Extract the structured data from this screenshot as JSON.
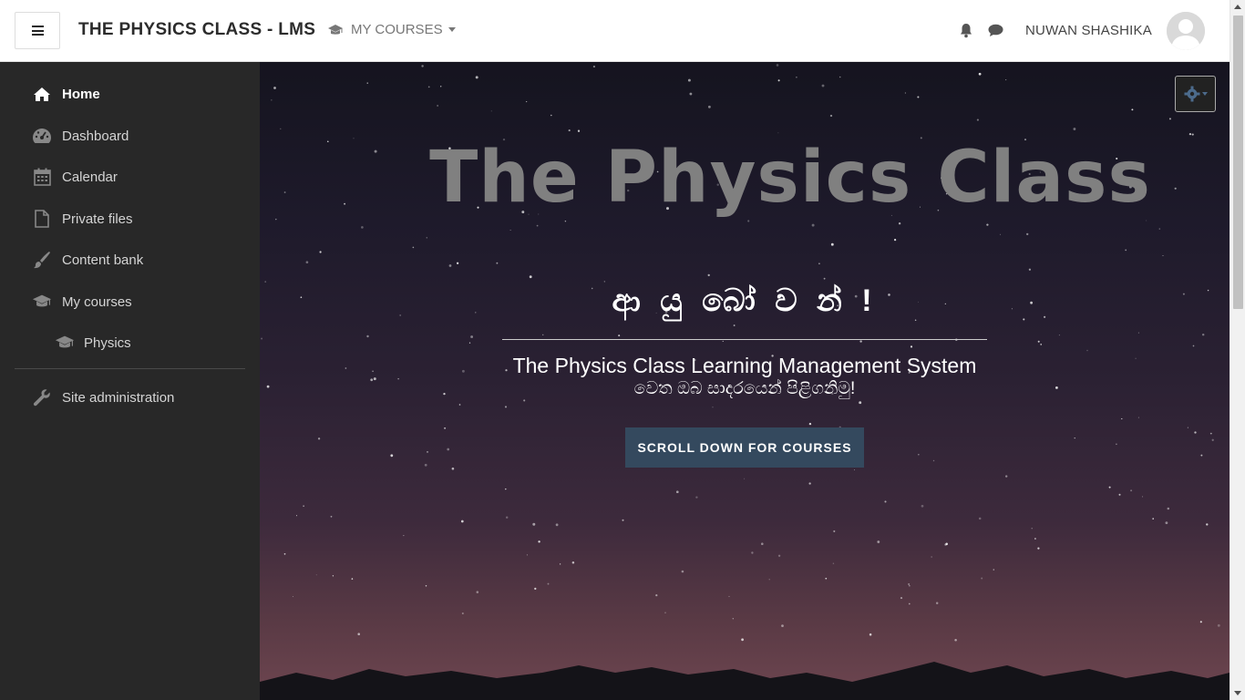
{
  "navbar": {
    "site_name": "THE PHYSICS CLASS - LMS",
    "mycourses_label": "MY COURSES",
    "username": "NUWAN SHASHIKA"
  },
  "sidebar": {
    "items": [
      {
        "label": "Home",
        "icon": "home-icon",
        "active": true
      },
      {
        "label": "Dashboard",
        "icon": "dashboard-icon"
      },
      {
        "label": "Calendar",
        "icon": "calendar-icon"
      },
      {
        "label": "Private files",
        "icon": "file-icon"
      },
      {
        "label": "Content bank",
        "icon": "paintbrush-icon"
      },
      {
        "label": "My courses",
        "icon": "graduation-cap-icon"
      },
      {
        "label": "Physics",
        "icon": "graduation-cap-icon",
        "sub": true
      },
      {
        "label": "Site administration",
        "icon": "wrench-icon"
      }
    ]
  },
  "hero": {
    "title": "The Physics Class",
    "welcome": "ආ යු බෝ ව න් !",
    "subtitle_line1": "The Physics Class Learning Management System",
    "subtitle_line2": "වෙත ඔබ සාදරයෙන් පිළිගනිමු!",
    "button_label": "SCROLL DOWN FOR COURSES"
  },
  "colors": {
    "sidebar_bg": "#282828",
    "button_bg": "#34495e",
    "title_gray": "#808080",
    "gear_blue": "#4c6b8c"
  }
}
